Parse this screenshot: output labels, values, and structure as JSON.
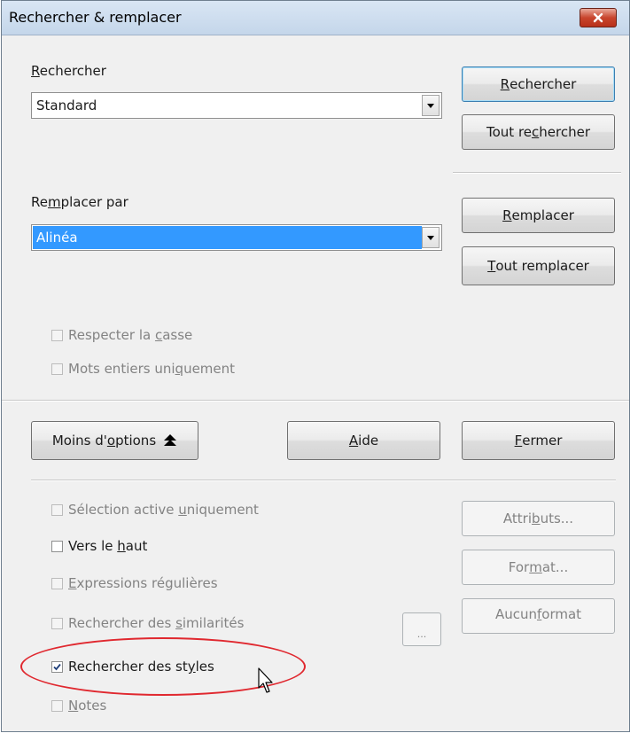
{
  "window": {
    "title": "Rechercher & remplacer"
  },
  "search": {
    "label_pre": "",
    "label_key": "R",
    "label_post": "echercher",
    "value": "Standard"
  },
  "replace": {
    "label_pre": "Re",
    "label_key": "m",
    "label_post": "placer par",
    "value": "Alinéa"
  },
  "buttons": {
    "find": {
      "pre": "",
      "key": "R",
      "post": "echercher"
    },
    "find_all": {
      "pre": "Tout re",
      "key": "c",
      "post": "hercher"
    },
    "replace": {
      "pre": "",
      "key": "R",
      "post": "emplacer"
    },
    "replace_all": {
      "pre": "",
      "key": "T",
      "post": "out remplacer"
    },
    "fewer_options": {
      "pre": "Moins d'",
      "key": "o",
      "post": "ptions"
    },
    "help": {
      "pre": "",
      "key": "A",
      "post": "ide"
    },
    "close": {
      "pre": "",
      "key": "F",
      "post": "ermer"
    },
    "attributes": {
      "pre": "Attri",
      "key": "b",
      "post": "uts..."
    },
    "format": {
      "pre": "For",
      "key": "m",
      "post": "at..."
    },
    "no_format": {
      "pre": "Aucun ",
      "key": "f",
      "post": "ormat"
    },
    "similarity_options": "..."
  },
  "options": {
    "match_case": {
      "pre": "Respecter la ",
      "key": "c",
      "post": "asse",
      "checked": false,
      "enabled": false
    },
    "whole_words": {
      "pre": "Mots entiers uni",
      "key": "q",
      "post": "uement",
      "checked": false,
      "enabled": false
    },
    "current_selection": {
      "pre": "Sélection active ",
      "key": "u",
      "post": "niquement",
      "checked": false,
      "enabled": false
    },
    "backwards": {
      "pre": "Vers le ",
      "key": "h",
      "post": "aut",
      "checked": false,
      "enabled": true
    },
    "regex": {
      "pre": "",
      "key": "E",
      "post": "xpressions régulières",
      "checked": false,
      "enabled": false
    },
    "similarity": {
      "pre": "Rechercher des ",
      "key": "s",
      "post": "imilarités",
      "checked": false,
      "enabled": false
    },
    "search_styles": {
      "pre": "Rechercher des st",
      "key": "y",
      "post": "les",
      "checked": true,
      "enabled": true
    },
    "notes": {
      "pre": "",
      "key": "N",
      "post": "otes",
      "checked": false,
      "enabled": false
    }
  },
  "colors": {
    "highlight": "#e0282f",
    "selection": "#3399ff"
  }
}
